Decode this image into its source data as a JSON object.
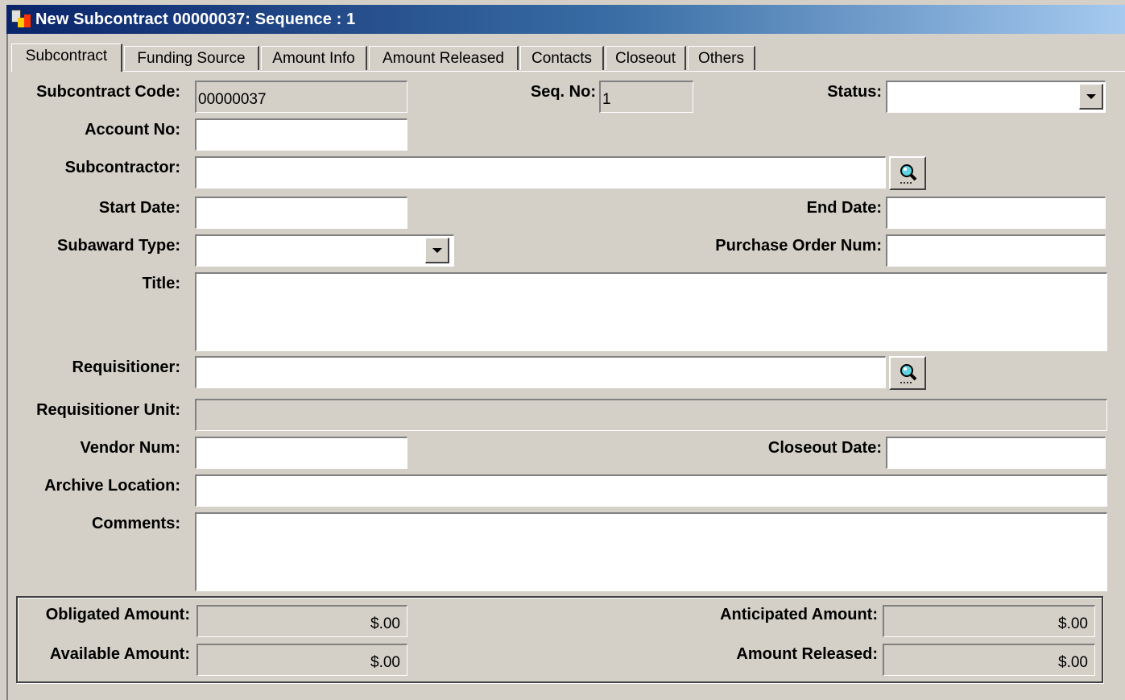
{
  "window": {
    "title": "New Subcontract 00000037: Sequence : 1"
  },
  "tabs": [
    {
      "label": "Subcontract",
      "active": true
    },
    {
      "label": "Funding Source"
    },
    {
      "label": "Amount Info"
    },
    {
      "label": "Amount Released"
    },
    {
      "label": "Contacts"
    },
    {
      "label": "Closeout"
    },
    {
      "label": "Others"
    }
  ],
  "form": {
    "subcontract_code": {
      "label": "Subcontract Code:",
      "value": "00000037"
    },
    "seq_no": {
      "label": "Seq. No:",
      "value": "1"
    },
    "status": {
      "label": "Status:",
      "value": ""
    },
    "account_no": {
      "label": "Account No:",
      "value": ""
    },
    "subcontractor": {
      "label": "Subcontractor:",
      "value": ""
    },
    "start_date": {
      "label": "Start Date:",
      "value": ""
    },
    "end_date": {
      "label": "End Date:",
      "value": ""
    },
    "subaward_type": {
      "label": "Subaward Type:",
      "value": ""
    },
    "purchase_order_num": {
      "label": "Purchase Order Num:",
      "value": ""
    },
    "title": {
      "label": "Title:",
      "value": ""
    },
    "requisitioner": {
      "label": "Requisitioner:",
      "value": ""
    },
    "requisitioner_unit": {
      "label": "Requisitioner Unit:",
      "value": ""
    },
    "vendor_num": {
      "label": "Vendor Num:",
      "value": ""
    },
    "closeout_date": {
      "label": "Closeout Date:",
      "value": ""
    },
    "archive_location": {
      "label": "Archive Location:",
      "value": ""
    },
    "comments": {
      "label": "Comments:",
      "value": ""
    }
  },
  "amounts": {
    "obligated": {
      "label": "Obligated Amount:",
      "value": "$.00"
    },
    "anticipated": {
      "label": "Anticipated Amount:",
      "value": "$.00"
    },
    "available": {
      "label": "Available Amount:",
      "value": "$.00"
    },
    "released": {
      "label": "Amount Released:",
      "value": "$.00"
    }
  },
  "icons": {
    "search_button": "magnifier-icon",
    "dropdown_button": "chevron-down-icon"
  }
}
